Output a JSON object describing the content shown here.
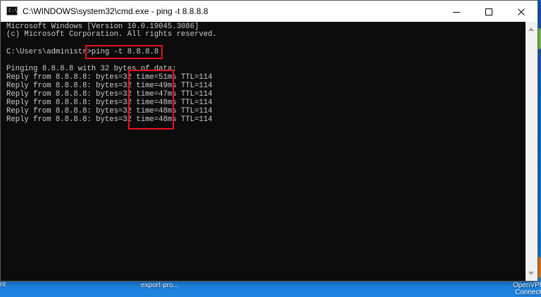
{
  "window": {
    "title": "C:\\WINDOWS\\system32\\cmd.exe - ping  -t 8.8.8.8",
    "icon_text": "C:\\",
    "min_icon": "minimize-icon",
    "max_icon": "maximize-icon",
    "close_icon": "close-icon"
  },
  "console": {
    "lines": [
      "Microsoft Windows [Version 10.0.19045.3086]",
      "(c) Microsoft Corporation. All rights reserved.",
      "",
      "C:\\Users\\administr>ping -t 8.8.8.8",
      "",
      "Pinging 8.8.8.8 with 32 bytes of data:",
      "Reply from 8.8.8.8: bytes=32 time=51ms TTL=114",
      "Reply from 8.8.8.8: bytes=32 time=49ms TTL=114",
      "Reply from 8.8.8.8: bytes=32 time=47ms TTL=114",
      "Reply from 8.8.8.8: bytes=32 time=48ms TTL=114",
      "Reply from 8.8.8.8: bytes=32 time=48ms TTL=114",
      "Reply from 8.8.8.8: bytes=32 time=48ms TTL=114"
    ]
  },
  "highlights": {
    "command": "ping -t 8.8.8.8",
    "times": "time=51ms … time=48ms",
    "color": "#e81123"
  },
  "desktop": {
    "icons": [
      {
        "label": "export-pro..."
      },
      {
        "label": "OpenVPN"
      },
      {
        "label": "Connect"
      },
      {
        "label": "nt"
      }
    ]
  },
  "colors": {
    "console_bg": "#0c0c0c",
    "console_text": "#cccccc",
    "titlebar_bg": "#ffffff",
    "desktop_bg": "#0b6fd0",
    "highlight": "#e81123"
  }
}
